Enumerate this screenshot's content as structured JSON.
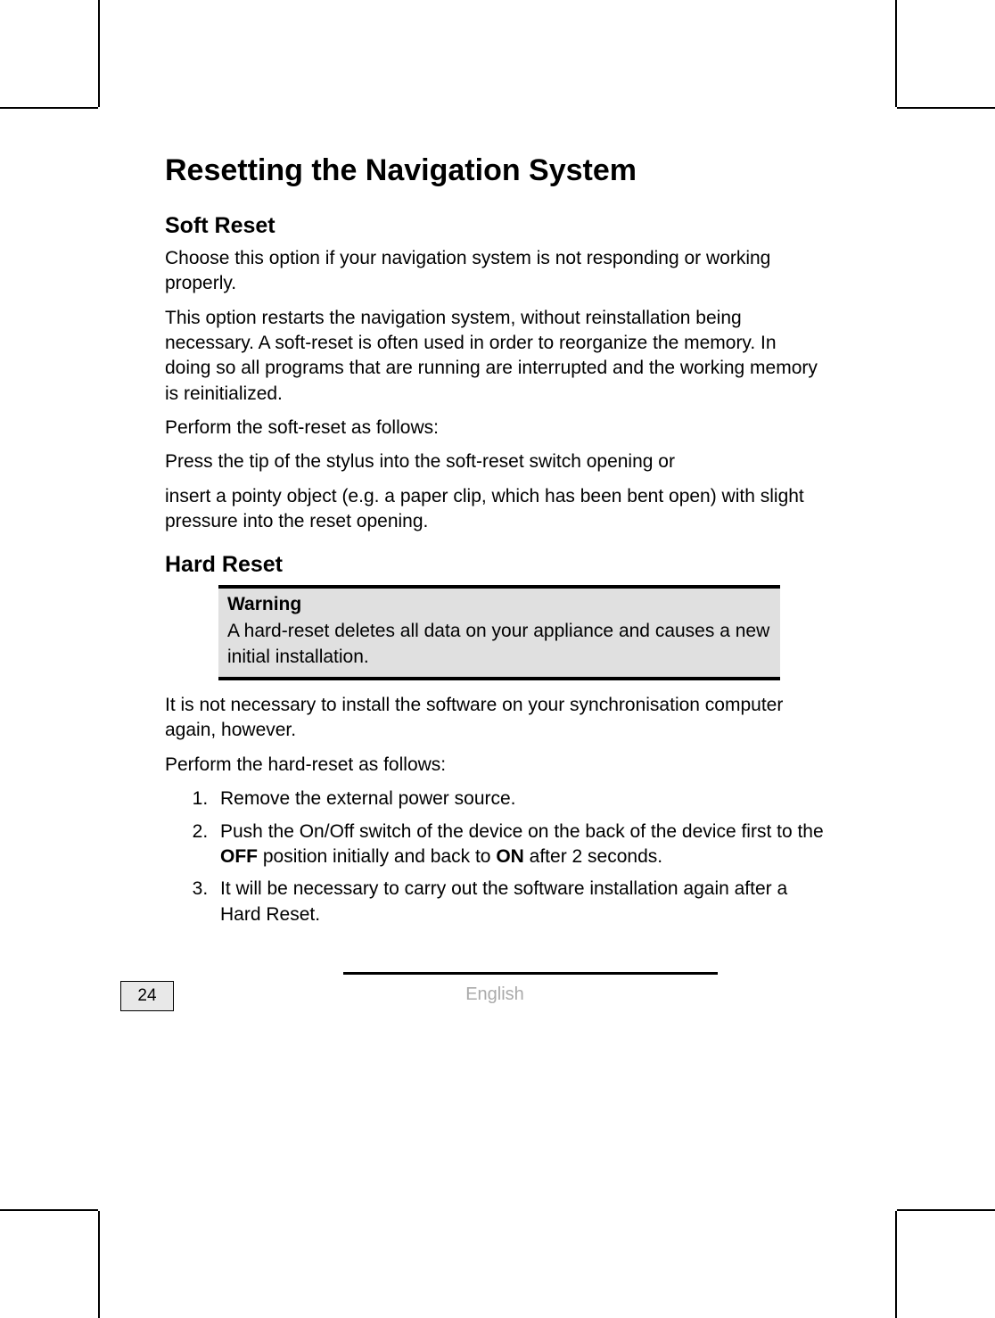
{
  "main_heading": "Resetting the Navigation System",
  "soft_reset": {
    "heading": "Soft Reset",
    "p1": "Choose this option if your navigation system is not responding or working properly.",
    "p2": "This option restarts the navigation system, without reinstallation being necessary. A soft-reset is often used in order to reorganize the memory. In doing so all programs that are running are interrupted and the working memory is reinitialized.",
    "p3": "Perform the soft-reset as follows:",
    "p4": "Press the tip of the stylus into the soft-reset switch opening or",
    "p5": "insert a pointy object (e.g. a paper clip, which has been bent open) with slight pressure into the reset opening."
  },
  "hard_reset": {
    "heading": "Hard Reset",
    "warning_title": "Warning",
    "warning_body": "A hard-reset deletes all data on your appliance and causes a new initial installation.",
    "p1": "It is not necessary to install the software on your synchronisation computer again, however.",
    "p2": "Perform the hard-reset as follows:",
    "steps": {
      "s1": "Remove the external power source.",
      "s2_a": "Push the On/Off switch of the device on the back of the device first to the ",
      "s2_off": "OFF",
      "s2_b": " position initially and back to ",
      "s2_on": "ON",
      "s2_c": " after 2 seconds.",
      "s3": "It will be necessary to carry out the software installation again after a Hard Reset."
    }
  },
  "footer": {
    "page_number": "24",
    "language": "English"
  }
}
